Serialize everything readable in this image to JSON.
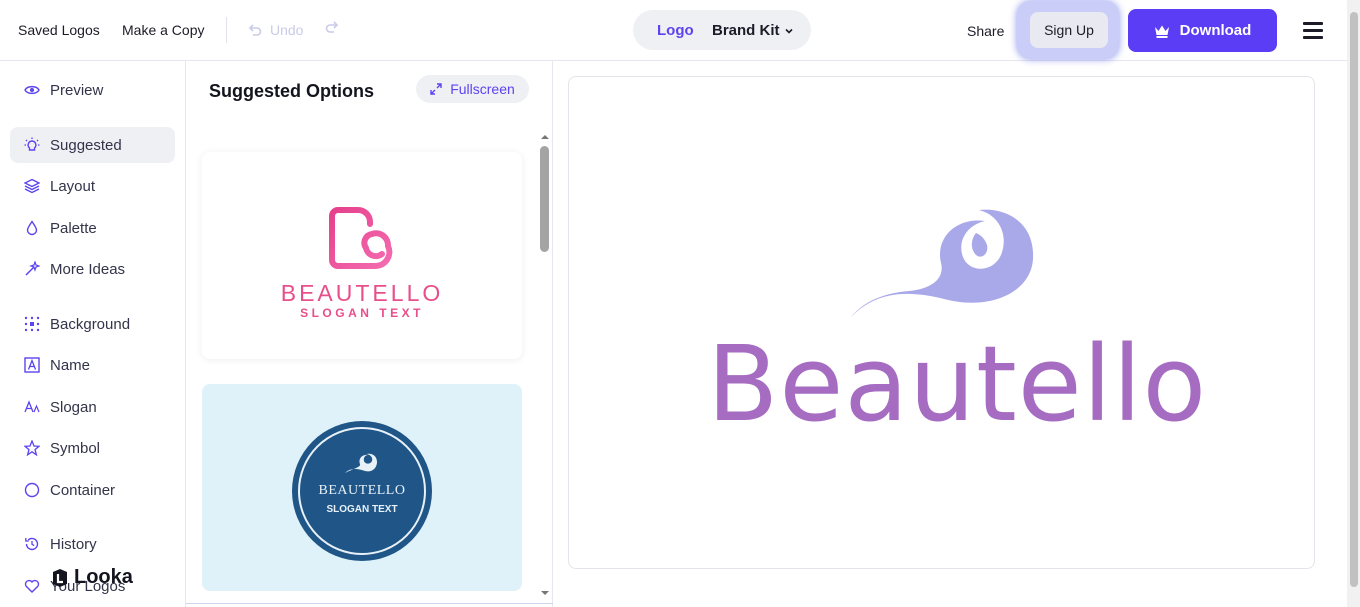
{
  "topbar": {
    "saved_logos": "Saved Logos",
    "make_copy": "Make a Copy",
    "undo": "Undo",
    "tab_logo": "Logo",
    "tab_brand_kit": "Brand Kit",
    "share": "Share",
    "sign_up": "Sign Up",
    "download": "Download"
  },
  "sidebar": {
    "items": [
      {
        "label": "Preview",
        "icon": "eye-icon"
      },
      {
        "label": "Suggested",
        "icon": "lightbulb-icon",
        "active": true
      },
      {
        "label": "Layout",
        "icon": "layers-icon"
      },
      {
        "label": "Palette",
        "icon": "droplet-icon"
      },
      {
        "label": "More Ideas",
        "icon": "magic-wand-icon"
      },
      {
        "label": "Background",
        "icon": "background-grid-icon"
      },
      {
        "label": "Name",
        "icon": "text-box-icon"
      },
      {
        "label": "Slogan",
        "icon": "font-slogan-icon"
      },
      {
        "label": "Symbol",
        "icon": "star-icon"
      },
      {
        "label": "Container",
        "icon": "circle-icon"
      },
      {
        "label": "History",
        "icon": "history-icon"
      },
      {
        "label": "Your Logos",
        "icon": "heart-icon"
      }
    ],
    "brand": "Looka"
  },
  "panel": {
    "title": "Suggested Options",
    "fullscreen": "Fullscreen",
    "cards": [
      {
        "name": "BEAUTELLO",
        "slogan": "SLOGAN TEXT",
        "color": "#e84e8a"
      },
      {
        "name": "BEAUTELLO",
        "slogan": "SLOGAN TEXT",
        "color": "#1f5687",
        "bg": "#dff2f9"
      }
    ]
  },
  "preview": {
    "brand_name": "Beautello",
    "text_color": "#a56cc1",
    "symbol_color": "#a9a9ea"
  },
  "colors": {
    "accent": "#5b3df5",
    "accent_text": "#5b44ef"
  }
}
